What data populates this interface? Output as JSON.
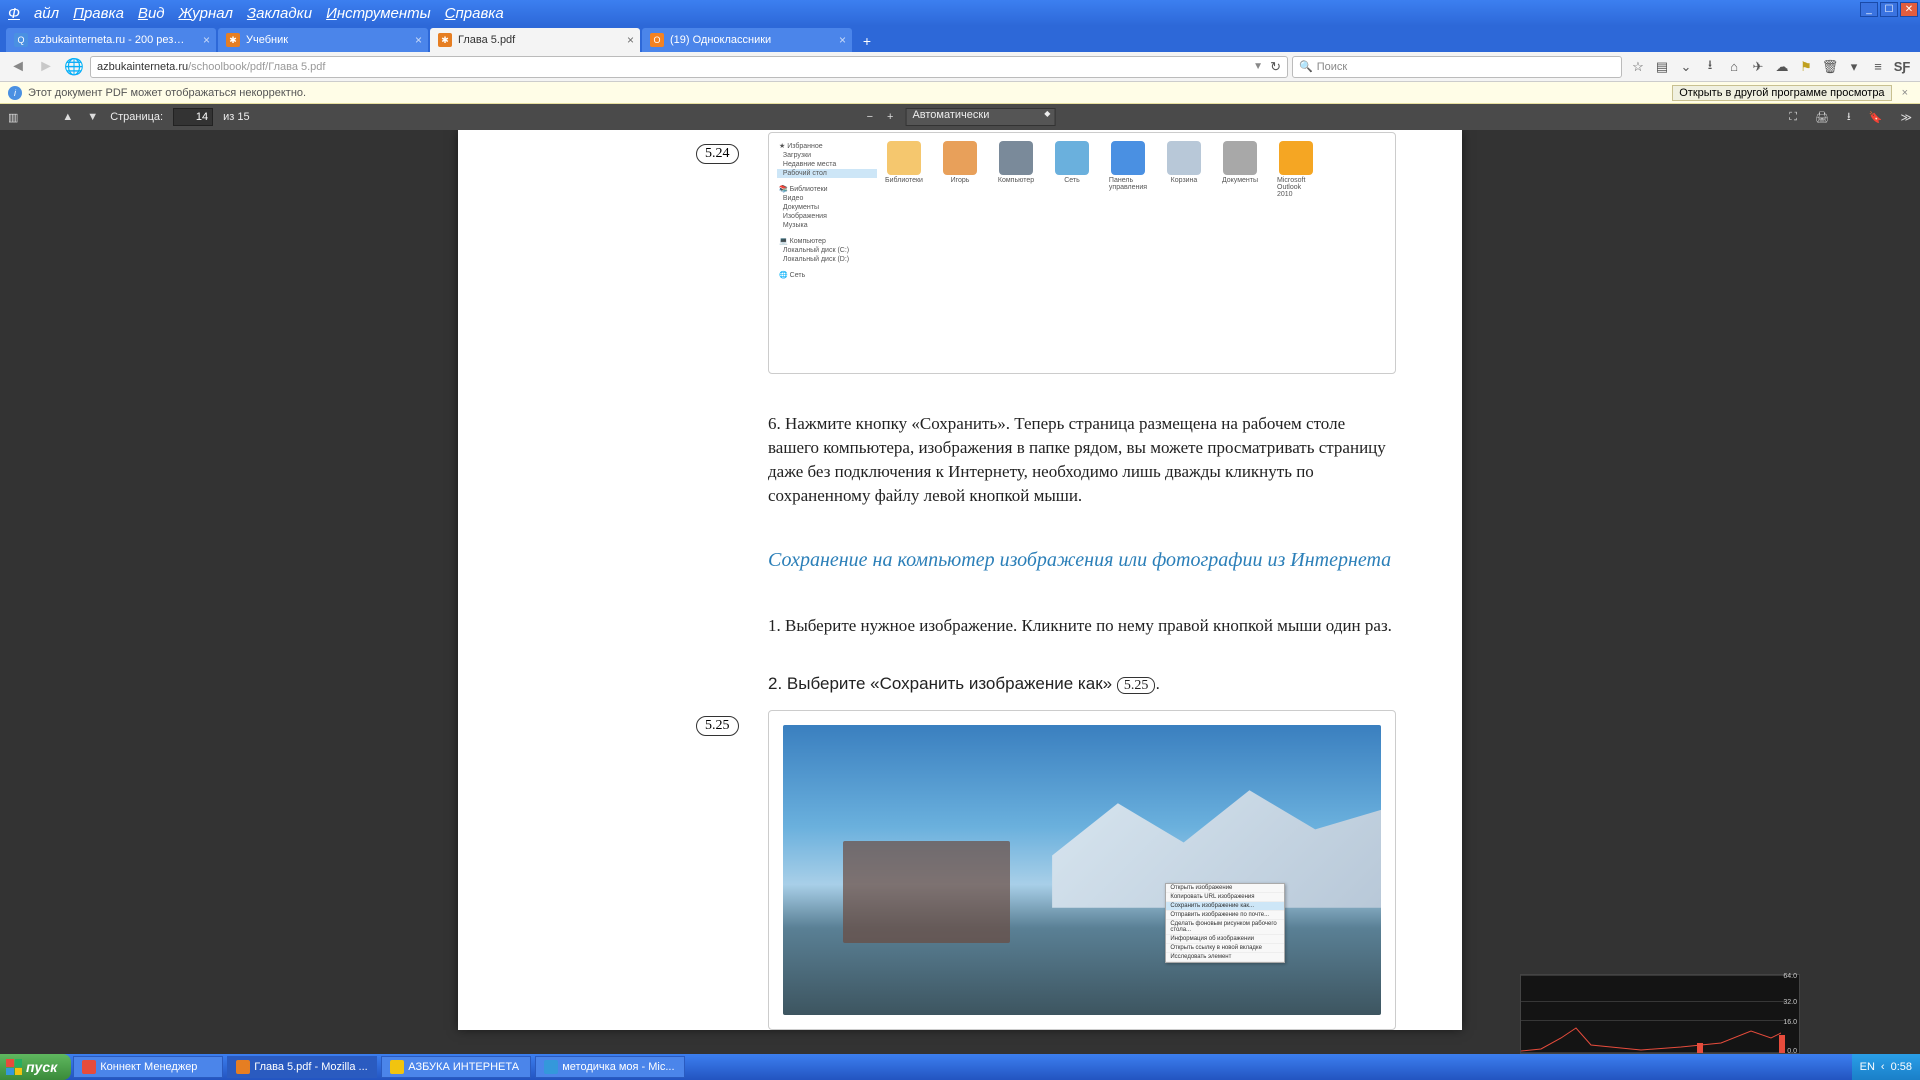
{
  "window_controls": {
    "minimize": "_",
    "maximize": "☐",
    "close": "✕"
  },
  "menu": {
    "file": "Файл",
    "edit": "Правка",
    "view": "Вид",
    "history": "Журнал",
    "bookmarks": "Закладки",
    "tools": "Инструменты",
    "help": "Справка"
  },
  "tabs": [
    {
      "title": "azbukainterneta.ru - 200 рез…",
      "favicon_bg": "#4a90e2",
      "favicon_text": "Q",
      "active": false
    },
    {
      "title": "Учебник",
      "favicon_bg": "#e67e22",
      "favicon_text": "✱",
      "active": false
    },
    {
      "title": "Глава 5.pdf",
      "favicon_bg": "#e67e22",
      "favicon_text": "✱",
      "active": true
    },
    {
      "title": "(19) Одноклассники",
      "favicon_bg": "#f48221",
      "favicon_text": "O",
      "active": false
    }
  ],
  "address": {
    "domain": "azbukainterneta.ru",
    "path": "/schoolbook/pdf/Глава 5.pdf"
  },
  "search_placeholder": "Поиск",
  "notification": {
    "text": "Этот документ PDF может отображаться некорректно.",
    "button": "Открыть в другой программе просмотра"
  },
  "pdf_toolbar": {
    "page_label": "Страница:",
    "current_page": "14",
    "total_pages": "из 15",
    "zoom_mode": "Автоматически"
  },
  "page_content": {
    "fig_label_524": "5.24",
    "fig_label_525": "5.25",
    "fig_ref_525": "5.25",
    "explorer_items": [
      "Избранное",
      "Загрузки",
      "Недавние места",
      "Рабочий стол",
      "Библиотеки",
      "Видео",
      "Документы",
      "Изображения",
      "Музыка",
      "Компьютер",
      "Локальный диск (C:)",
      "Локальный диск (D:)",
      "Сеть"
    ],
    "explorer_icons": [
      "Библиотеки",
      "Игорь",
      "Компьютер",
      "Сеть",
      "Панель управления",
      "Корзина",
      "Документы",
      "Microsoft Outlook 2010"
    ],
    "step6": "6. Нажмите кнопку «Сохранить». Теперь страница размещена на рабочем столе вашего компьютера, изображения в папке рядом, вы можете просматривать страницу даже без подключения к Интернету, необходимо лишь дважды кликнуть по сохраненному файлу левой кнопкой мыши.",
    "heading": "Сохранение на компьютер изображения или фотографии из Интернета",
    "step1": "1. Выберите нужное изображение. Кликните по нему правой кнопкой мыши один раз.",
    "step2_before": "2. Выберите «Сохранить изображение как» ",
    "step2_after": ".",
    "ctx_menu_items": [
      "Открыть изображение",
      "Копировать URL изображения",
      "Сохранить изображение как...",
      "Отправить изображение по почте...",
      "Сделать фоновым рисунком рабочего стола...",
      "Информация об изображении",
      "Открыть ссылку в новой вкладке",
      "Исследовать элемент"
    ]
  },
  "taskbar": {
    "start": "пуск",
    "items": [
      {
        "title": "Коннект Менеджер",
        "bg": "#e74c3c"
      },
      {
        "title": "Глава 5.pdf - Mozilla ...",
        "bg": "#e67e22",
        "active": true
      },
      {
        "title": "АЗБУКА ИНТЕРНЕТА",
        "bg": "#f1c40f"
      },
      {
        "title": "методичка моя - Mic...",
        "bg": "#3498db"
      }
    ],
    "lang": "EN",
    "time": "0:58"
  },
  "graph": {
    "labels": [
      "64.0",
      "32.0",
      "16.0",
      "0.0"
    ]
  }
}
